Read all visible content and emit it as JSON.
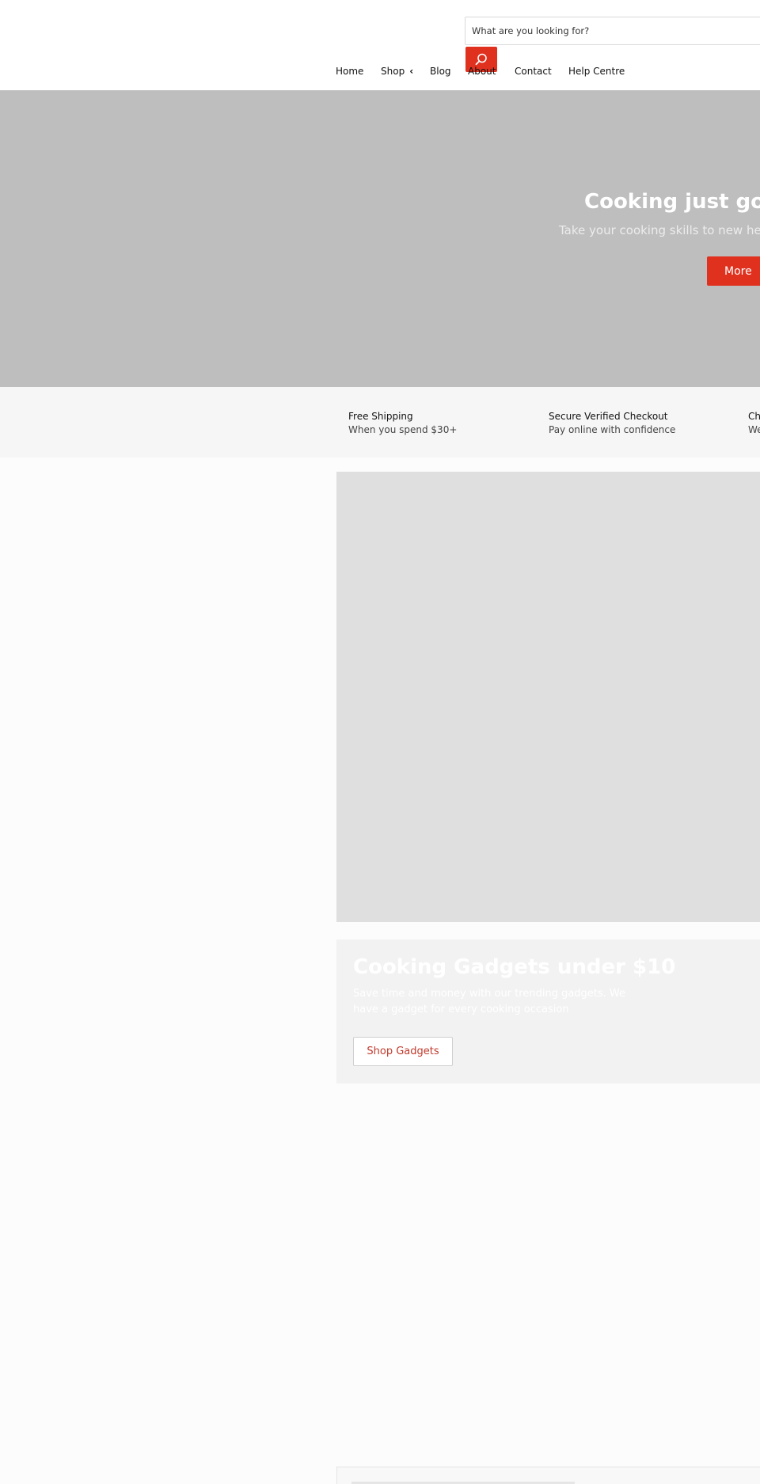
{
  "search": {
    "placeholder": "What are you looking for?",
    "button_icon": "search-icon"
  },
  "nav": {
    "items": [
      {
        "label": "Home"
      },
      {
        "label": "Shop",
        "icon": "chevron-left-icon",
        "chevron": "‹"
      },
      {
        "label": "Blog"
      },
      {
        "label": "About"
      },
      {
        "label": "Contact"
      },
      {
        "label": "Help Centre"
      }
    ]
  },
  "hero": {
    "title": "Cooking just got a w",
    "subtitle": "Take your cooking skills to new heights",
    "button_label": "More"
  },
  "usps": [
    {
      "title": "Free Shipping",
      "subtitle": "When you spend $30+"
    },
    {
      "title": "Secure Verified Checkout",
      "subtitle": "Pay online with confidence"
    },
    {
      "title": "Ch",
      "subtitle": "We"
    }
  ],
  "promo": {
    "title": "Cooking Gadgets under $10",
    "text": "Save time and money with our trending gadgets. We have a gadget for every cooking occasion",
    "button_label": "Shop Gadgets"
  },
  "colors": {
    "accent": "#e0301e",
    "hero_bg": "#bebebe",
    "usp_bg": "#f6f6f6",
    "promo_image_bg": "#dfdfdf",
    "promo_panel_bg": "#f2f2f2"
  }
}
